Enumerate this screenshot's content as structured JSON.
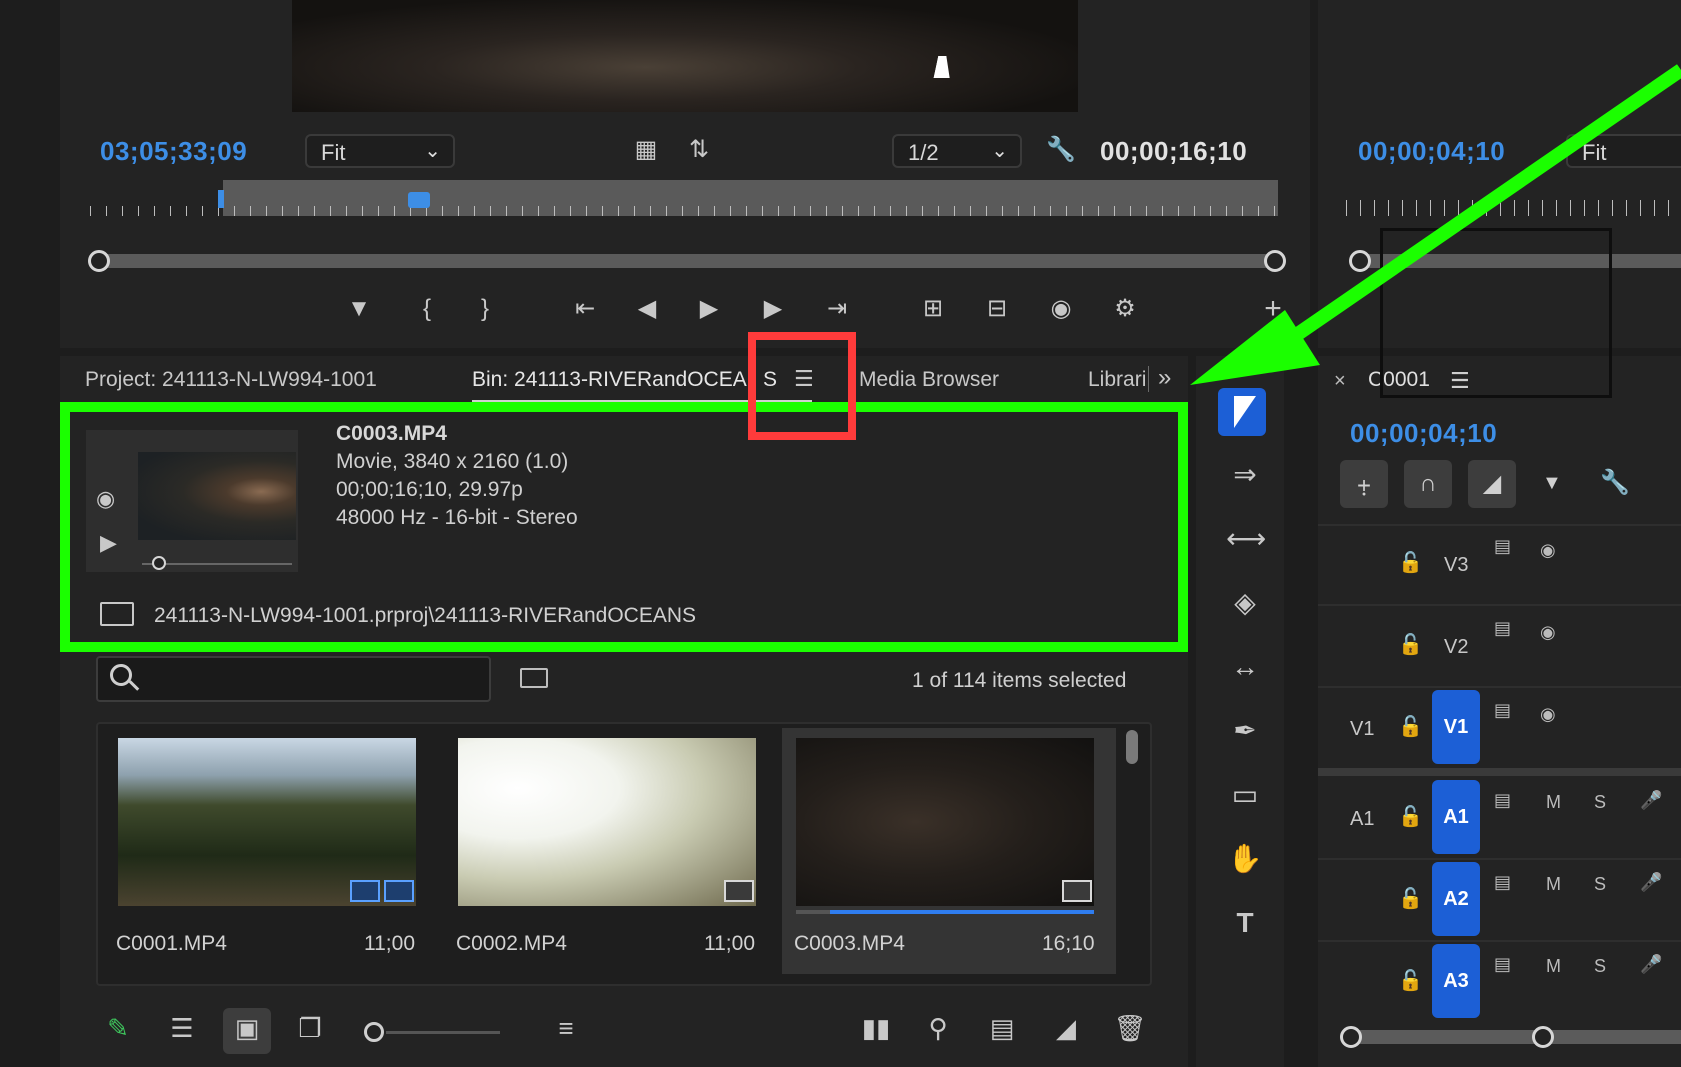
{
  "source_monitor": {
    "timecode": "03;05;33;09",
    "zoom": "Fit",
    "resolution": "1/2",
    "duration": "00;00;16;10"
  },
  "program_monitor": {
    "timecode": "00;00;04;10",
    "zoom": "Fit"
  },
  "project_panel": {
    "tabs": [
      {
        "label": "Project: 241113-N-LW994-1001"
      },
      {
        "label": "Bin: 241113-RIVERandOCEA"
      },
      {
        "label": "S"
      },
      {
        "label": "Media Browser"
      },
      {
        "label": "Librari"
      }
    ],
    "overflow_icon": "double-chevron-right-icon",
    "preview": {
      "filename": "C0003.MP4",
      "line2": "Movie, 3840 x 2160 (1.0)",
      "line3": "00;00;16;10, 29.97p",
      "line4": "48000 Hz - 16-bit - Stereo",
      "path": "241113-N-LW994-1001.prproj\\241113-RIVERandOCEANS"
    },
    "search": {
      "placeholder": ""
    },
    "selection_status": "1 of 114 items selected",
    "items": [
      {
        "name": "C0001.MP4",
        "duration": "11;00",
        "selected": false
      },
      {
        "name": "C0002.MP4",
        "duration": "11;00",
        "selected": false
      },
      {
        "name": "C0003.MP4",
        "duration": "16;10",
        "selected": true
      }
    ]
  },
  "timeline": {
    "sequence_name": "C0001",
    "timecode": "00;00;04;10",
    "tracks": [
      {
        "src": "",
        "target": "V3",
        "targeted": false
      },
      {
        "src": "",
        "target": "V2",
        "targeted": false
      },
      {
        "src": "V1",
        "target": "V1",
        "targeted": true
      },
      {
        "src": "A1",
        "target": "A1",
        "targeted": true,
        "audio": true
      },
      {
        "src": "",
        "target": "A2",
        "targeted": true,
        "audio": true
      },
      {
        "src": "",
        "target": "A3",
        "targeted": true,
        "audio": true
      }
    ],
    "mute_label": "M",
    "solo_label": "S"
  },
  "colors": {
    "accent_blue": "#3d8ee6",
    "track_target_blue": "#1c5fd6",
    "annotation_green": "#1bff00",
    "annotation_red": "#ff3b3b"
  }
}
